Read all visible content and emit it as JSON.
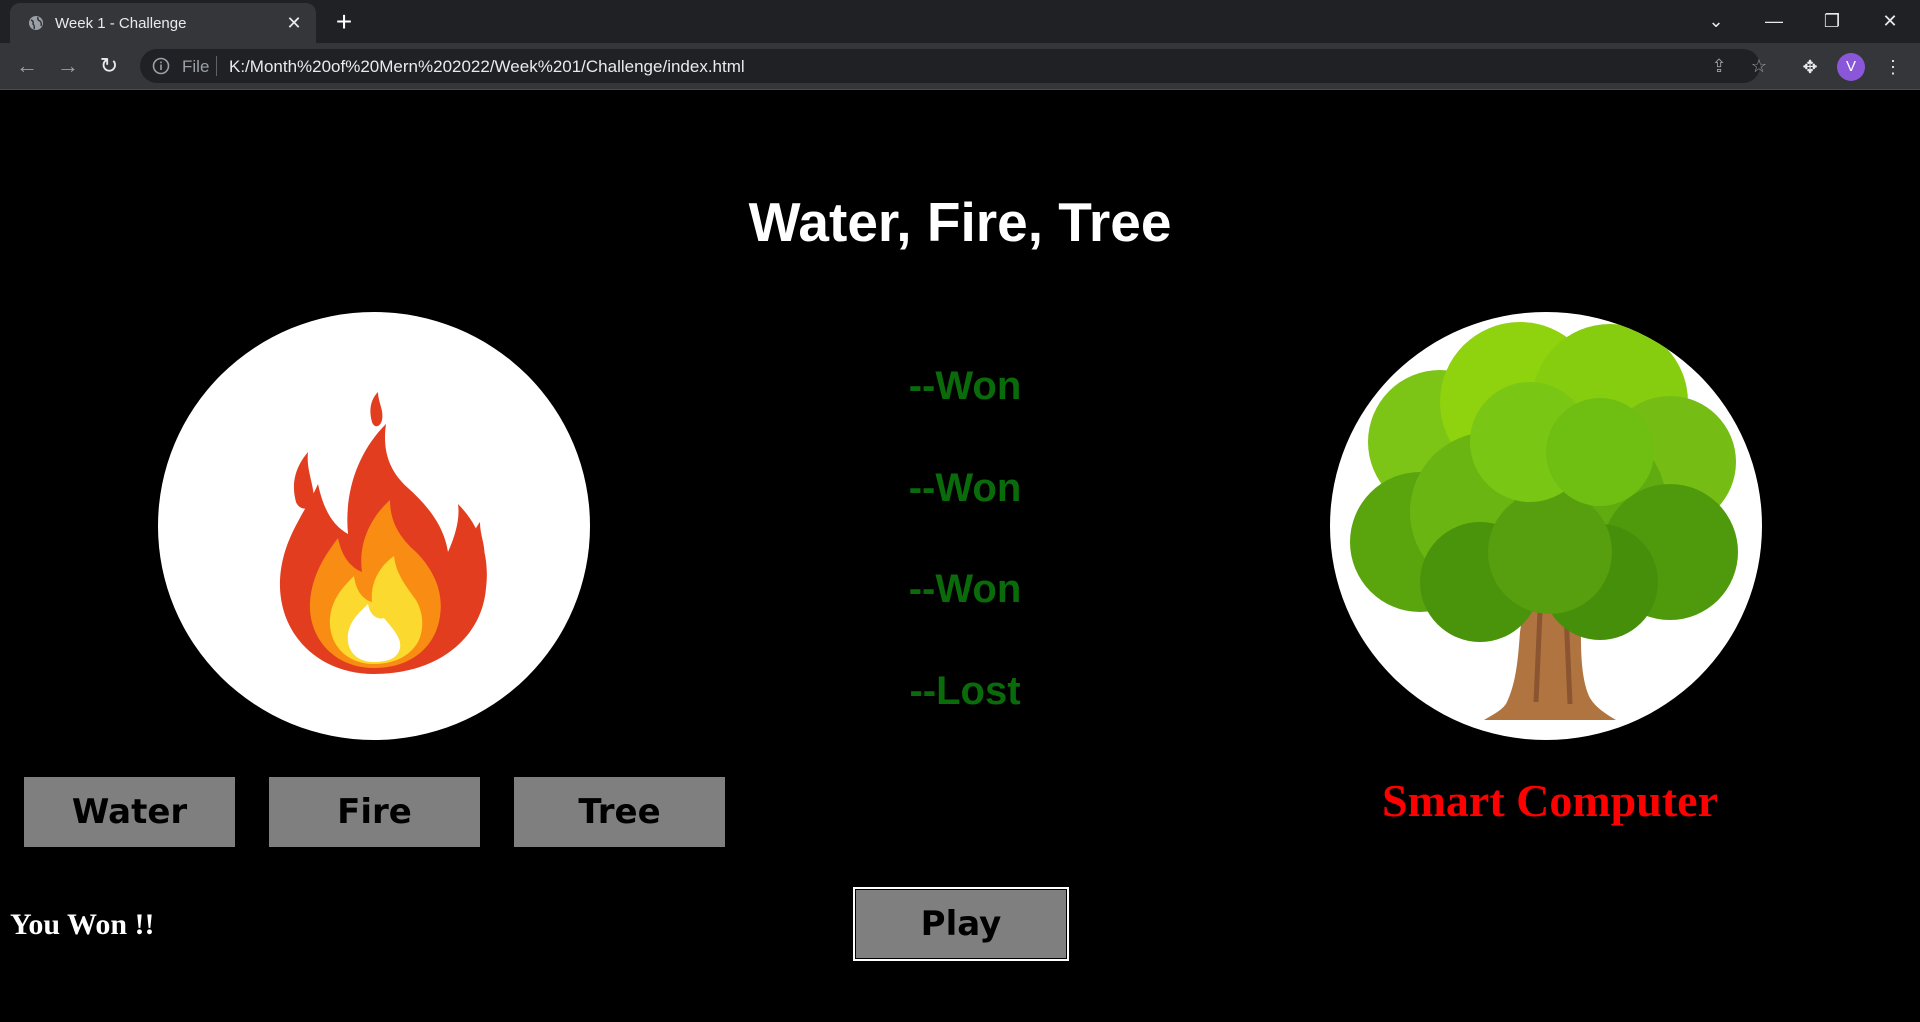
{
  "browser": {
    "tab_title": "Week 1 - Challenge",
    "tab_close": "✕",
    "new_tab": "+",
    "omnibox_label": "File",
    "url": "K:/Month%20of%20Mern%202022/Week%201/Challenge/index.html",
    "profile_initial": "V"
  },
  "page": {
    "title": "Water, Fire, Tree",
    "player_choice_icon": "fire-icon",
    "computer_choice_icon": "tree-icon",
    "results": [
      "--Won",
      "--Won",
      "--Won",
      "--Lost"
    ],
    "buttons": {
      "water": "Water",
      "fire": "Fire",
      "tree": "Tree",
      "play": "Play"
    },
    "computer_label": "Smart Computer",
    "status": "You Won !!"
  },
  "colors": {
    "background": "#000000",
    "result_text": "#0a6b0a",
    "computer_label": "#ff0000",
    "button_bg": "#7f7f7f"
  }
}
